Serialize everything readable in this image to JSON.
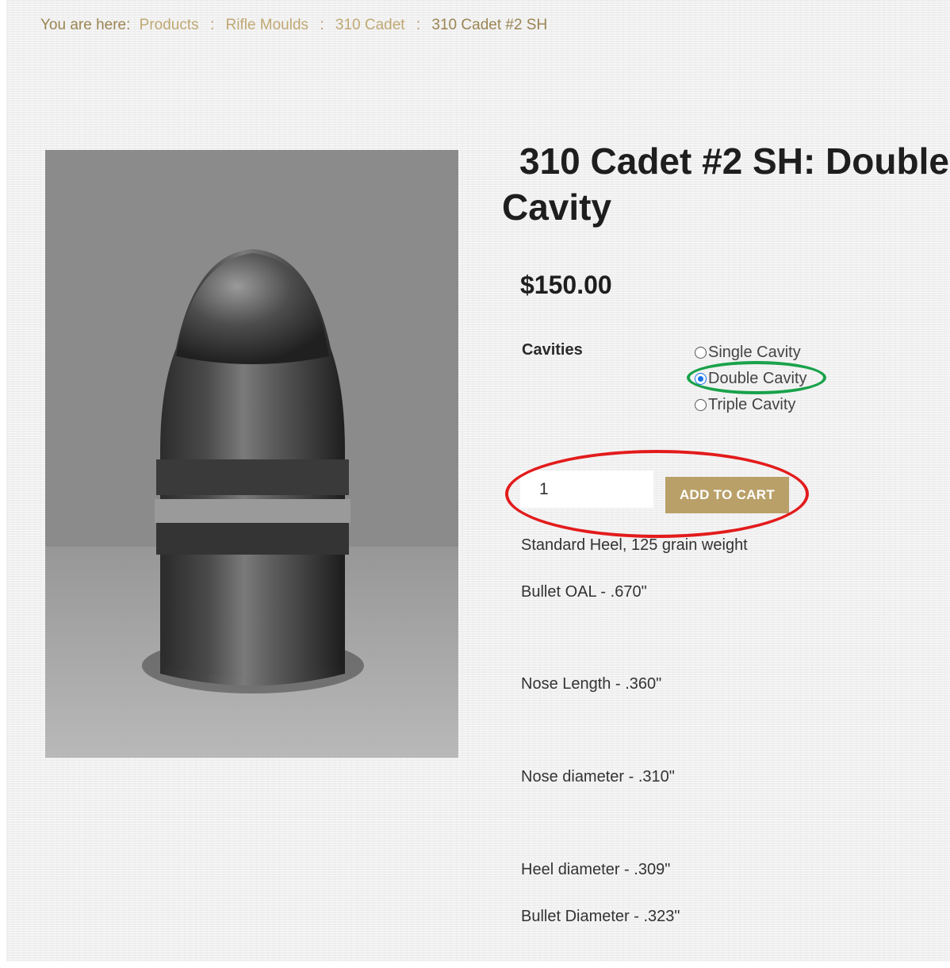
{
  "breadcrumb": {
    "label": "You are here:",
    "items": [
      "Products",
      "Rifle Moulds",
      "310 Cadet"
    ],
    "current": "310 Cadet #2 SH",
    "separator": ":"
  },
  "product": {
    "title": "310 Cadet #2 SH: Double Cavity",
    "price": "$150.00",
    "image": "bullet-photo"
  },
  "cavities": {
    "label": "Cavities",
    "options": [
      "Single Cavity",
      "Double Cavity",
      "Triple Cavity"
    ],
    "selected": "Double Cavity"
  },
  "cart": {
    "quantity": "1",
    "add_label": "ADD TO CART"
  },
  "details": [
    "Standard Heel, 125 grain weight",
    "Bullet OAL - .670\"",
    "Nose Length - .360\"",
    "Nose diameter - .310\"",
    "Heel diameter - .309\"",
    "Bullet Diameter - .323\""
  ],
  "annotations": {
    "green_ring_color": "#19a24a",
    "red_ring_color": "#e31b1b"
  },
  "colors": {
    "accent": "#b9a069",
    "breadcrumb": "#b49a62",
    "radio_selected": "#1a73e8"
  }
}
